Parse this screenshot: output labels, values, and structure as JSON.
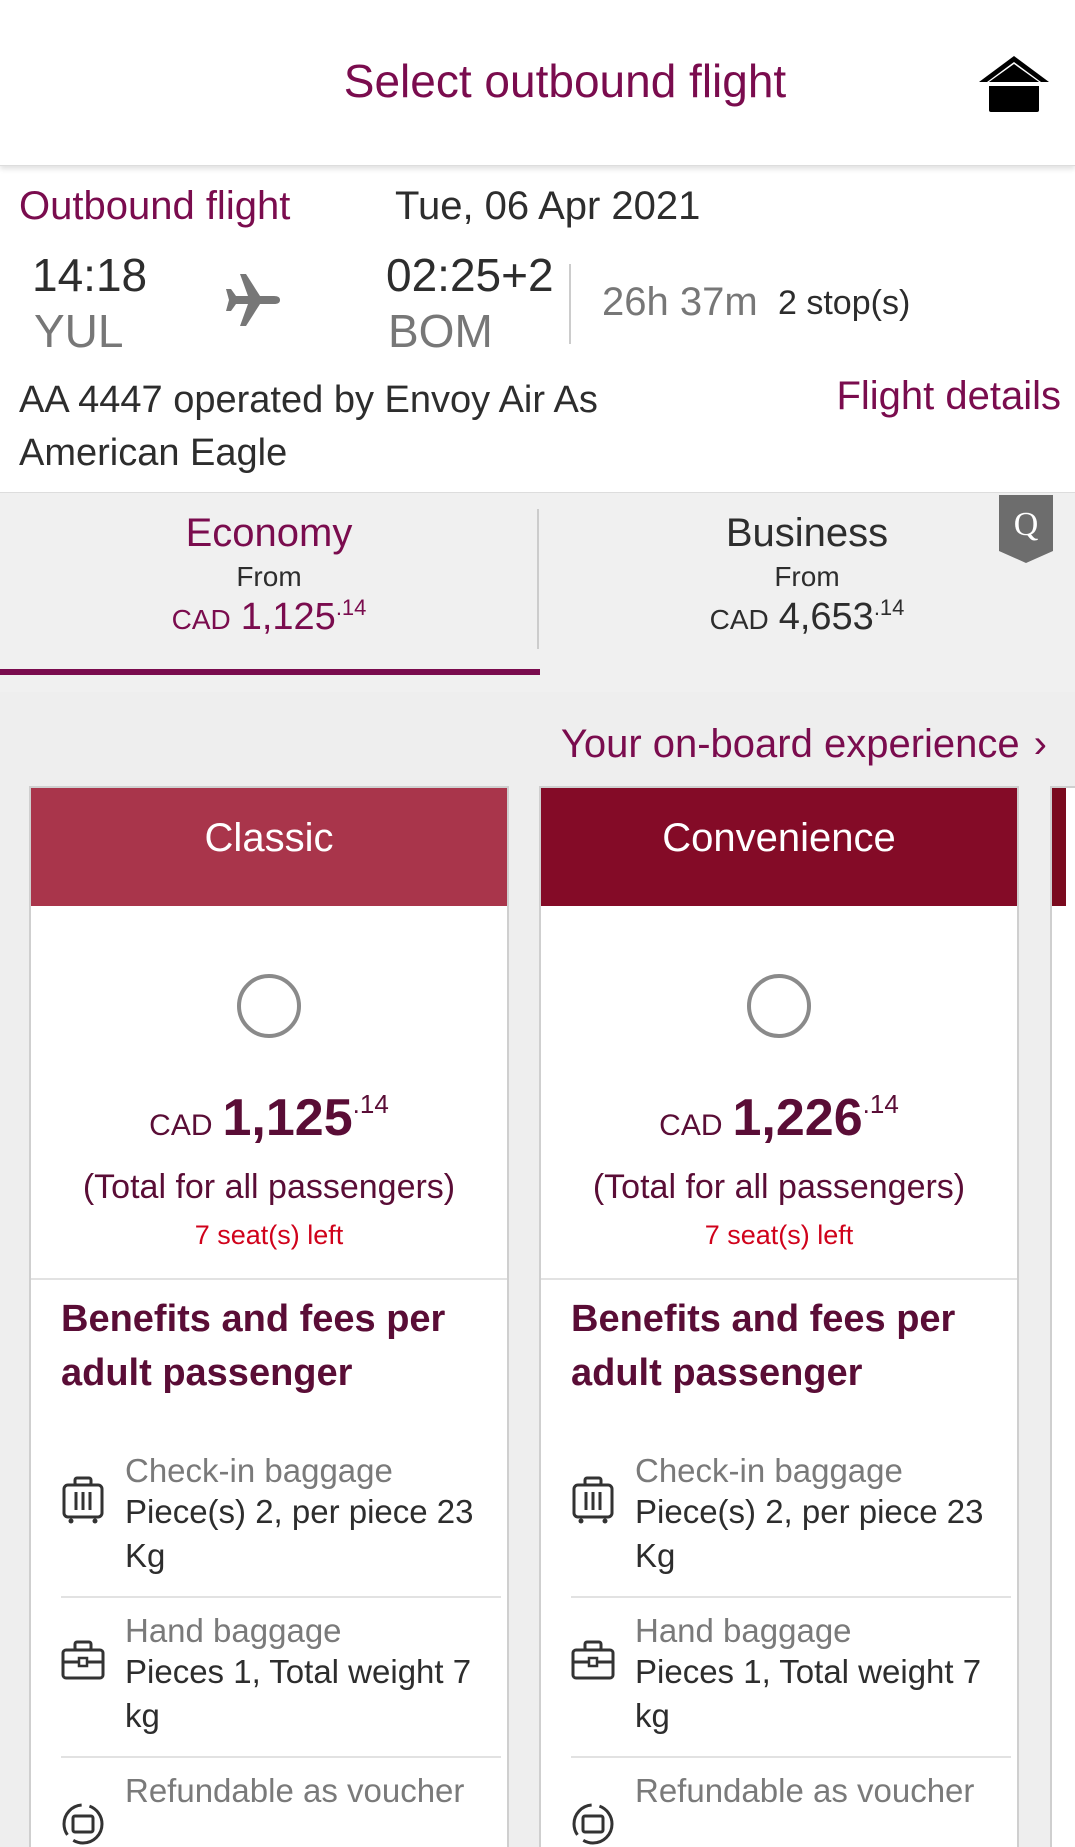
{
  "header": {
    "title": "Select outbound flight",
    "home_icon": "home-icon"
  },
  "summary": {
    "label": "Outbound flight",
    "date": "Tue, 06 Apr 2021",
    "departure_time": "14:18",
    "departure_code": "YUL",
    "plane_icon": "plane-icon",
    "arrival_time": "02:25+2",
    "arrival_code": "BOM",
    "duration": "26h 37m",
    "stops": "2 stop(s)",
    "operator": "AA 4447 operated by Envoy Air As American Eagle",
    "details_link": "Flight details"
  },
  "cabins": [
    {
      "name": "Economy",
      "from": "From",
      "currency": "CAD",
      "price": "1,125",
      "cents": ".14",
      "selected": true
    },
    {
      "name": "Business",
      "from": "From",
      "currency": "CAD",
      "price": "4,653",
      "cents": ".14",
      "selected": false
    }
  ],
  "badge": {
    "letter": "Q"
  },
  "onboard_link": {
    "label": "Your on-board experience",
    "chevron": "›"
  },
  "fares": [
    {
      "name": "Classic",
      "color": "#a9354b",
      "currency": "CAD",
      "price": "1,125",
      "cents": ".14",
      "total_note": "(Total for all passengers)",
      "seats_left": "7 seat(s) left",
      "benefits_title": "Benefits and fees per adult passenger",
      "benefits": [
        {
          "icon": "suitcase-icon",
          "title": "Check-in baggage",
          "desc": "Piece(s) 2, per piece 23 Kg"
        },
        {
          "icon": "briefcase-icon",
          "title": "Hand baggage",
          "desc": "Pieces 1, Total weight 7 kg"
        },
        {
          "icon": "refund-voucher-icon",
          "title": "Refundable as voucher",
          "desc": ""
        }
      ]
    },
    {
      "name": "Convenience",
      "color": "#840b27",
      "currency": "CAD",
      "price": "1,226",
      "cents": ".14",
      "total_note": "(Total for all passengers)",
      "seats_left": "7 seat(s) left",
      "benefits_title": "Benefits and fees per adult passenger",
      "benefits": [
        {
          "icon": "suitcase-icon",
          "title": "Check-in baggage",
          "desc": "Piece(s) 2, per piece 23 Kg"
        },
        {
          "icon": "briefcase-icon",
          "title": "Hand baggage",
          "desc": "Pieces 1, Total weight 7 kg"
        },
        {
          "icon": "refund-voucher-icon",
          "title": "Refundable as voucher",
          "desc": ""
        }
      ]
    }
  ]
}
